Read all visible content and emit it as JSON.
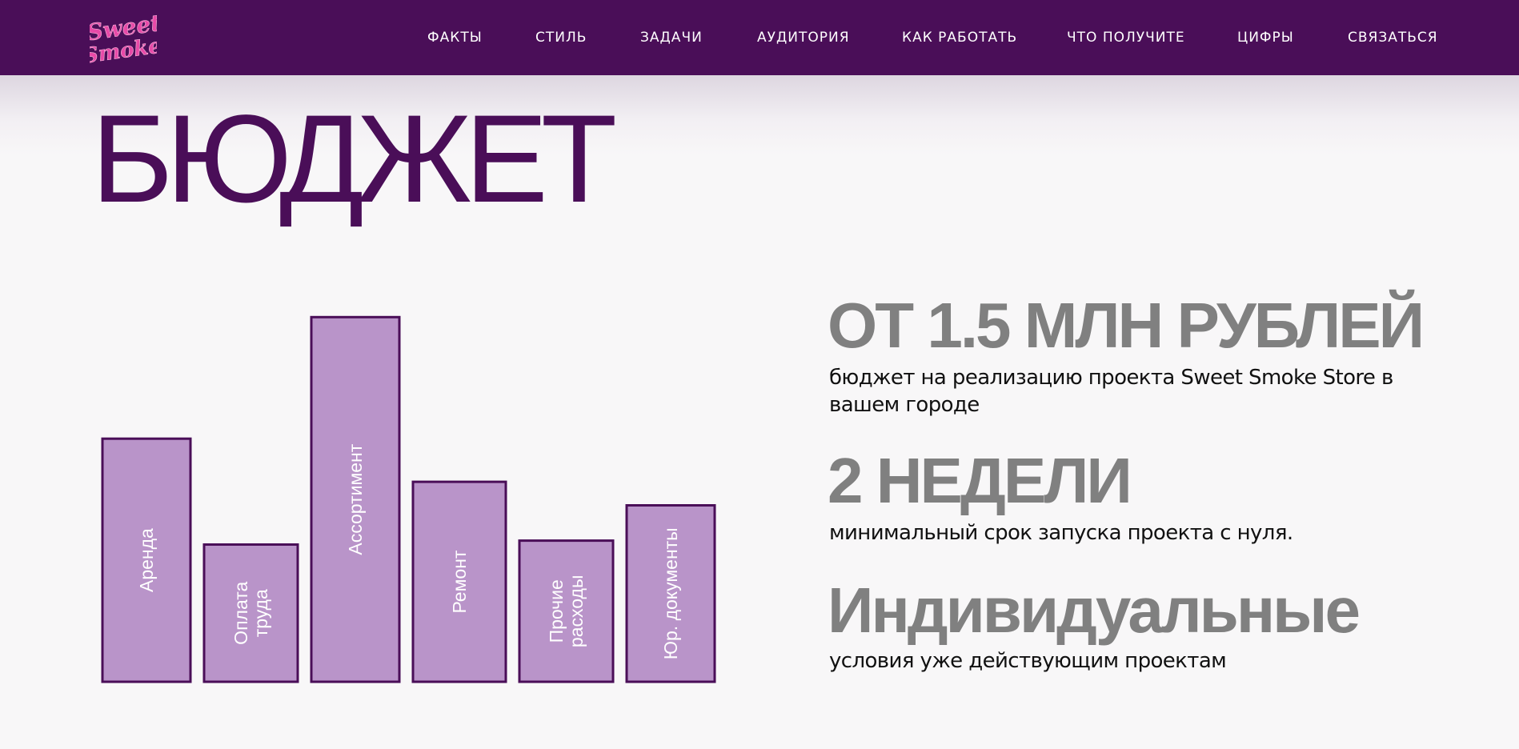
{
  "brand": {
    "logo_text": "Sweet Smoke",
    "colors": {
      "header_bg": "#4a0e58",
      "accent": "#4a0e58",
      "bar_fill": "#b994c9",
      "bar_stroke": "#4a0e58",
      "stat_gray": "#808080",
      "logo_pink": "#e84aa8"
    }
  },
  "nav": {
    "items": [
      "ФАКТЫ",
      "СТИЛЬ",
      "ЗАДАЧИ",
      "АУДИТОРИЯ",
      "КАК РАБОТАТЬ",
      "ЧТО ПОЛУЧИТЕ",
      "ЦИФРЫ",
      "СВЯЗАТЬСЯ"
    ]
  },
  "section": {
    "title": "БЮДЖЕТ"
  },
  "stats": [
    {
      "value": "ОТ 1.5 МЛН РУБЛЕЙ",
      "description": "бюджет на реализацию проекта Sweet Smoke Store в вашем городе"
    },
    {
      "value": "2 НЕДЕЛИ",
      "description": "минимальный срок запуска проекта с нуля."
    },
    {
      "value": "Индивидуальные",
      "description": "условия уже действующим проектам"
    }
  ],
  "chart_data": {
    "type": "bar",
    "categories": [
      "Аренда",
      "Оплата труда",
      "Ассортимент",
      "Ремонт",
      "Прочие расходы",
      "Юр. документы"
    ],
    "label_lines": [
      [
        "Аренда"
      ],
      [
        "Оплата",
        "труда"
      ],
      [
        "Ассортимент"
      ],
      [
        "Ремонт"
      ],
      [
        "Прочие",
        "расходы"
      ],
      [
        "Юр. документы"
      ]
    ],
    "values": [
      62,
      35,
      93,
      51,
      36,
      45
    ],
    "ylim": [
      0,
      100
    ],
    "grid": false,
    "legend": "none"
  }
}
